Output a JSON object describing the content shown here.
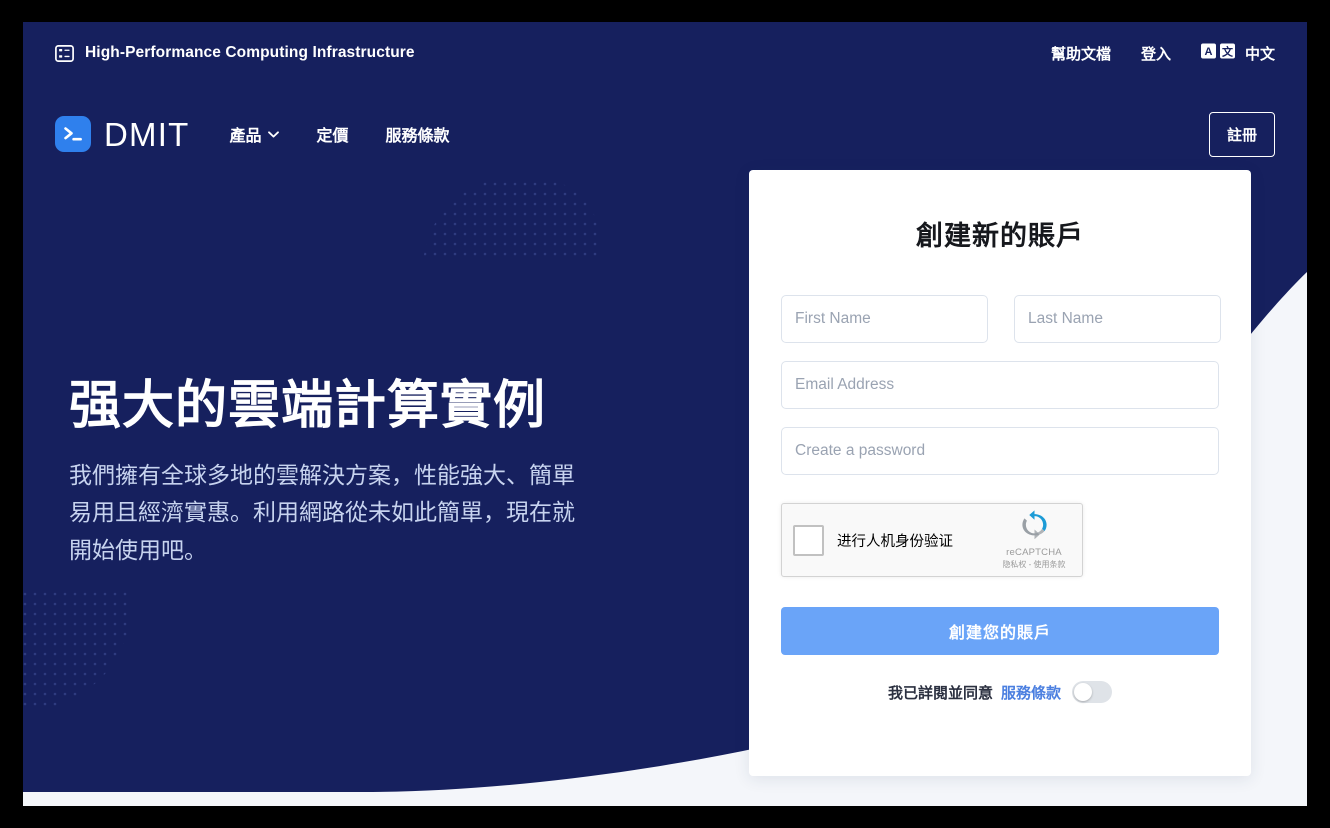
{
  "colors": {
    "navy": "#16205e",
    "navy_deep": "#131c54",
    "page_light": "#f4f6fa",
    "accent_blue": "#6aa4f8",
    "logo_blue": "#2f80ed",
    "link_blue": "#4b7fe0",
    "hero_text": "#c7d3ef"
  },
  "topbar": {
    "icon": "server-rack-icon",
    "title": "High-Performance Computing Infrastructure",
    "links": [
      {
        "label": "幫助文檔",
        "name": "help-docs-link"
      },
      {
        "label": "登入",
        "name": "login-link"
      }
    ],
    "language": {
      "icon": "translate-icon",
      "glyph_left": "A",
      "glyph_right": "文",
      "label": "中文"
    }
  },
  "navbar": {
    "logo_icon": "terminal-prompt-icon",
    "brand": "DMIT",
    "links": [
      {
        "label": "產品",
        "name": "nav-products",
        "has_chevron": true
      },
      {
        "label": "定價",
        "name": "nav-pricing",
        "has_chevron": false
      },
      {
        "label": "服務條款",
        "name": "nav-terms",
        "has_chevron": false
      }
    ],
    "register_label": "註冊"
  },
  "hero": {
    "heading": "强大的雲端計算實例",
    "paragraph": "我們擁有全球多地的雲解決方案，性能強大、簡單易用且經濟實惠。利用網路從未如此簡單，現在就開始使用吧。"
  },
  "signup": {
    "title": "創建新的賬戶",
    "fields": {
      "first_name_placeholder": "First Name",
      "last_name_placeholder": "Last Name",
      "email_placeholder": "Email Address",
      "password_placeholder": "Create a password",
      "first_name_value": "",
      "last_name_value": "",
      "email_value": "",
      "password_value": ""
    },
    "recaptcha": {
      "label": "进行人机身份验证",
      "brand": "reCAPTCHA",
      "terms": "隐私权 - 使用条款",
      "checked": false
    },
    "submit_label": "創建您的賬戶",
    "terms": {
      "text": "我已詳閱並同意",
      "link_label": "服務條款",
      "toggle_state": "off"
    }
  }
}
